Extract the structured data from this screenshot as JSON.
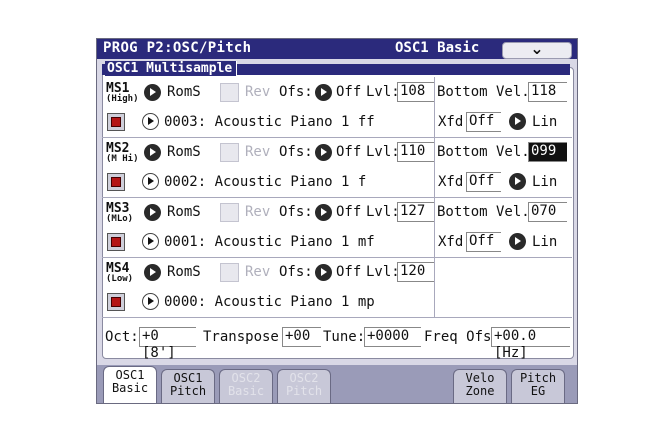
{
  "header": {
    "title": "PROG P2:OSC/Pitch",
    "page": "OSC1 Basic",
    "menu_icon": "chevron-down-icon"
  },
  "panel": {
    "title": "OSC1 Multisample"
  },
  "labels": {
    "roms": "RomS",
    "rev": "Rev",
    "ofs": "Ofs:",
    "off": "Off",
    "lvl": "Lvl:",
    "bottom_vel": "Bottom Vel.:",
    "xfd": "Xfd:",
    "xfd_value": "Off",
    "lin": "Lin"
  },
  "multisamples": [
    {
      "name": "MS1",
      "sub": "(High)",
      "level": "108",
      "sample": "0003: Acoustic Piano 1 ff",
      "bottom_vel": "118",
      "has_xfd": true
    },
    {
      "name": "MS2",
      "sub": "(M Hi)",
      "level": "110",
      "sample": "0002: Acoustic Piano 1  f",
      "bottom_vel": "099",
      "has_xfd": true
    },
    {
      "name": "MS3",
      "sub": "(MLo)",
      "level": "127",
      "sample": "0001: Acoustic Piano 1 mf",
      "bottom_vel": "070",
      "has_xfd": true
    },
    {
      "name": "MS4",
      "sub": "(Low)",
      "level": "120",
      "sample": "0000: Acoustic Piano 1 mp",
      "bottom_vel": "",
      "has_xfd": false
    }
  ],
  "pitch": {
    "oct_label": "Oct:",
    "oct_value": "+0 [8']",
    "transpose_label": "Transpose:",
    "transpose_value": "+00",
    "tune_label": "Tune:",
    "tune_value": "+0000",
    "freq_label": "Freq Ofs:",
    "freq_value": "+00.0 [Hz]"
  },
  "tabs": [
    {
      "line1": "OSC1",
      "line2": "Basic",
      "state": "active"
    },
    {
      "line1": "OSC1",
      "line2": "Pitch",
      "state": "normal"
    },
    {
      "line1": "OSC2",
      "line2": "Basic",
      "state": "disabled"
    },
    {
      "line1": "OSC2",
      "line2": "Pitch",
      "state": "disabled"
    },
    {
      "line1": "Velo",
      "line2": "Zone",
      "state": "normal"
    },
    {
      "line1": "Pitch",
      "line2": "EG",
      "state": "normal"
    }
  ]
}
